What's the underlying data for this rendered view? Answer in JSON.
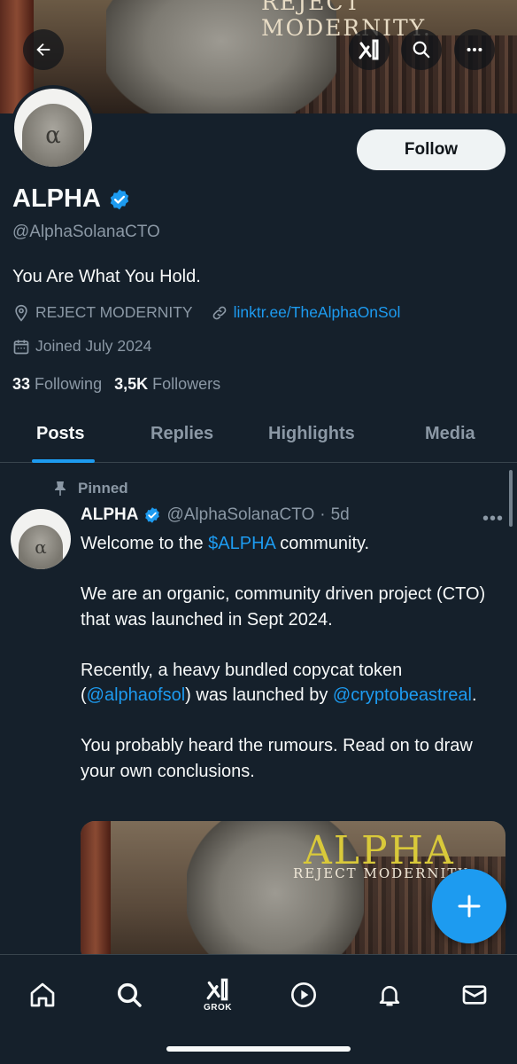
{
  "banner": {
    "text": "REJECT MODERNITY."
  },
  "profile": {
    "avatar_glyph": "α",
    "name": "ALPHA",
    "handle": "@AlphaSolanaCTO",
    "bio": "You Are What You Hold.",
    "location": "REJECT MODERNITY",
    "link": "linktr.ee/TheAlphaOnSol",
    "joined": "Joined July 2024",
    "following_count": "33",
    "following_label": "Following",
    "followers_count": "3,5K",
    "followers_label": "Followers",
    "follow_button": "Follow"
  },
  "tabs": [
    {
      "label": "Posts",
      "active": true
    },
    {
      "label": "Replies",
      "active": false
    },
    {
      "label": "Highlights",
      "active": false
    },
    {
      "label": "Media",
      "active": false
    }
  ],
  "post": {
    "pinned_label": "Pinned",
    "author": "ALPHA",
    "handle": "@AlphaSolanaCTO",
    "sep": "·",
    "time": "5d",
    "more": "•••",
    "p1_pre": "Welcome to the ",
    "p1_link": "$ALPHA",
    "p1_post": " community.",
    "p2": "We are an organic, community driven project (CTO) that was launched in Sept 2024.",
    "p3_pre": "Recently, a heavy bundled copycat token (",
    "p3_link1": "@alphaofsol",
    "p3_mid": ") was launched by ",
    "p3_link2": "@cryptobeastreal",
    "p3_post": ".",
    "p4": "You probably heard the rumours. Read on to draw your own conclusions.",
    "media_title": "ALPHA",
    "media_subtitle": "REJECT MODERNITY"
  },
  "nav": {
    "grok_label": "GROK"
  },
  "colors": {
    "background": "#15202b",
    "accent": "#1d9bf0",
    "muted": "#8b98a5",
    "text": "#f7f9f9",
    "follow_bg": "#eff3f4"
  },
  "icons": [
    "back-arrow-icon",
    "grok-icon",
    "search-icon",
    "more-icon",
    "verified-badge-icon",
    "location-icon",
    "link-icon",
    "calendar-icon",
    "pin-icon",
    "plus-icon",
    "home-icon",
    "search-nav-icon",
    "grok-nav-icon",
    "video-icon",
    "bell-icon",
    "mail-icon"
  ]
}
